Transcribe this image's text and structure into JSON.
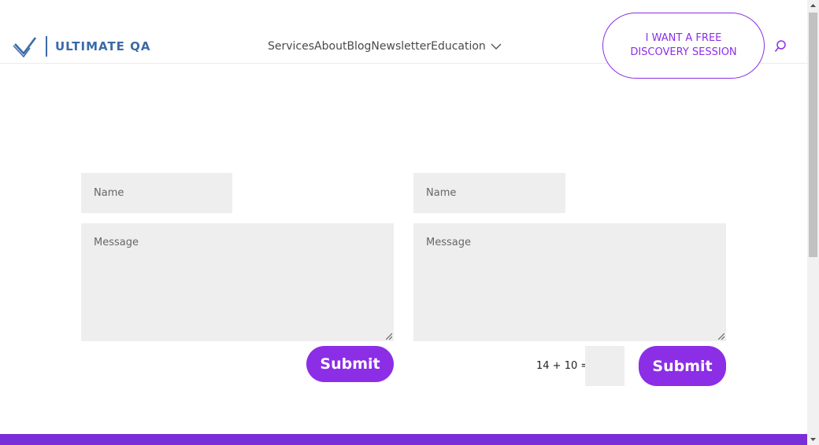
{
  "header": {
    "logo_text": "ULTIMATE QA",
    "nav": {
      "services": "Services",
      "about": "About",
      "blog": "Blog",
      "newsletter": "Newsletter",
      "education": "Education"
    },
    "cta_line1": "I WANT A FREE",
    "cta_line2": "DISCOVERY SESSION",
    "accent_color": "#8b2ee6",
    "brand_color": "#3b6aa8"
  },
  "form_left": {
    "name_placeholder": "Name",
    "message_placeholder": "Message",
    "submit_label": "Submit"
  },
  "form_right": {
    "name_placeholder": "Name",
    "message_placeholder": "Message",
    "captcha_text": "14 + 10 =",
    "submit_label": "Submit"
  },
  "icons": {
    "logo": "checkmark-logo-icon",
    "search": "search-icon",
    "dropdown": "chevron-down-icon"
  }
}
